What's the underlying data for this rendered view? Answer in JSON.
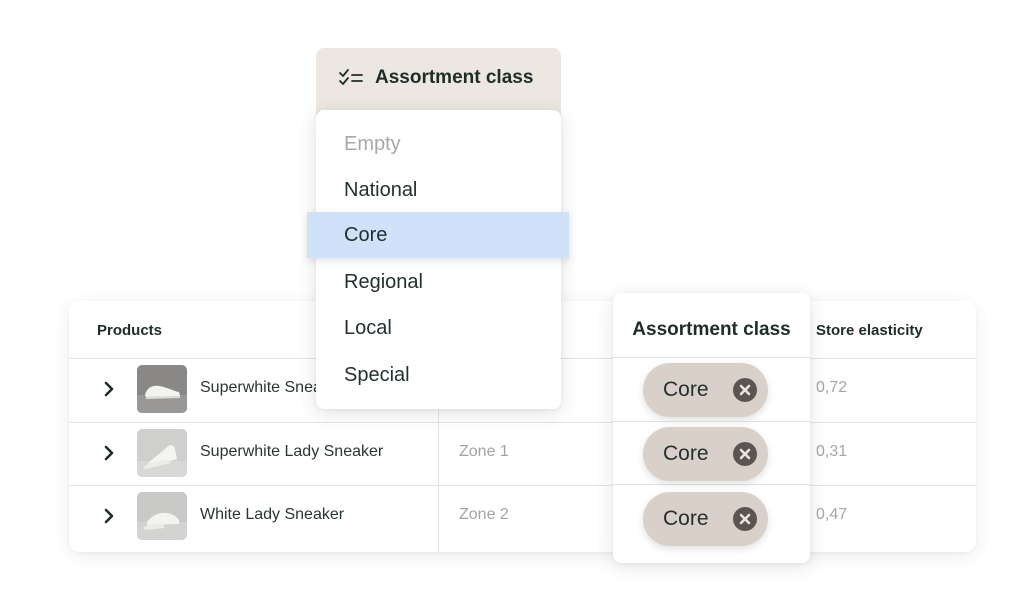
{
  "table": {
    "headers": {
      "products": "Products",
      "store_elasticity": "Store elasticity"
    },
    "rows": [
      {
        "product": "Superwhite Sneaker",
        "zone": "",
        "assortment_class": "Core",
        "store_elasticity": "0,72",
        "thumb_tone": "#8a8886"
      },
      {
        "product": "Superwhite Lady Sneaker",
        "zone": "Zone 1",
        "assortment_class": "Core",
        "store_elasticity": "0,31",
        "thumb_tone": "#cfcfcd"
      },
      {
        "product": "White Lady Sneaker",
        "zone": "Zone 2",
        "assortment_class": "Core",
        "store_elasticity": "0,47",
        "thumb_tone": "#c9c9c7"
      }
    ]
  },
  "assortment_column": {
    "title": "Assortment class",
    "chip_remove_icon": "close-circle-icon"
  },
  "dropdown": {
    "title": "Assortment class",
    "icon": "checklist-icon",
    "options": [
      {
        "label": "Empty",
        "state": "placeholder"
      },
      {
        "label": "National",
        "state": "normal"
      },
      {
        "label": "Core",
        "state": "selected"
      },
      {
        "label": "Regional",
        "state": "normal"
      },
      {
        "label": "Local",
        "state": "normal"
      },
      {
        "label": "Special",
        "state": "normal"
      }
    ]
  },
  "colors": {
    "chip_bg": "#d9d0c9",
    "selected_option_bg": "#cfe2fa",
    "dropdown_header_bg": "#ece8e1",
    "text_dark": "#1e2d2a"
  }
}
